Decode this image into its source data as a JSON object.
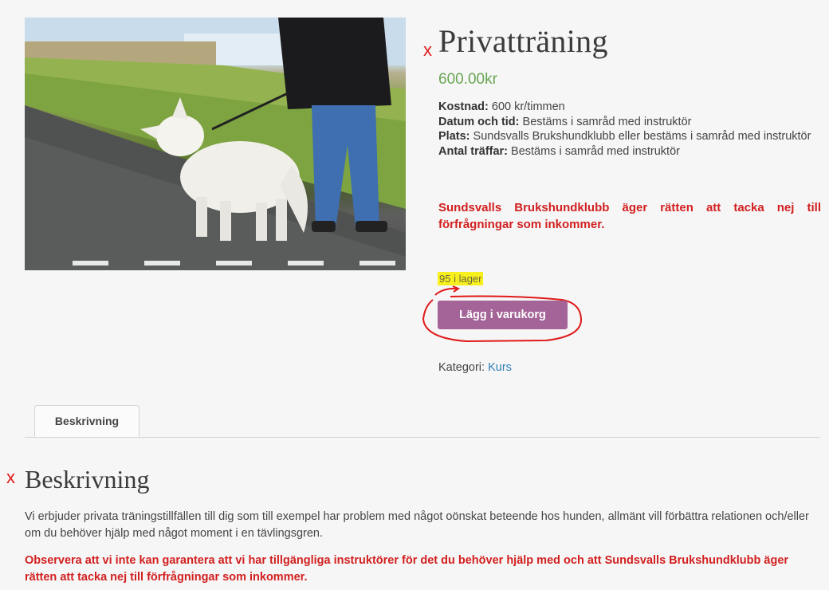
{
  "product": {
    "title": "Privatträning",
    "price": "600.00kr",
    "details": [
      {
        "label": "Kostnad:",
        "value": "600 kr/timmen"
      },
      {
        "label": "Datum och tid:",
        "value": "Bestäms i samråd med instruktör"
      },
      {
        "label": "Plats:",
        "value": "Sundsvalls Brukshundklubb eller bestäms i samråd med instruktör"
      },
      {
        "label": "Antal träffar:",
        "value": "Bestäms i samråd med instruktör"
      }
    ],
    "notice": "Sundsvalls Brukshundklubb äger rätten att tacka nej till förfrågningar som inkommer.",
    "stock": "95 i lager",
    "add_to_cart": "Lägg i varukorg",
    "category_label": "Kategori:",
    "category_value": "Kurs"
  },
  "tabs": [
    {
      "label": "Beskrivning"
    }
  ],
  "description": {
    "heading": "Beskrivning",
    "text": "Vi erbjuder privata träningstillfällen till dig som till exempel har problem med något oönskat beteende hos hunden, allmänt vill förbättra relationen och/eller om du behöver hjälp med något moment i en tävlingsgren.",
    "notice": "Observera att vi inte kan garantera att vi har tillgängliga instruktörer för det du behöver hjälp med och att Sundsvalls Brukshundklubb äger rätten att tacka nej till förfrågningar som inkommer."
  },
  "annotations": {
    "mark_glyph": "x",
    "mark_color": "#e01a1a"
  },
  "colors": {
    "price": "#69a653",
    "notice": "#d21f1f",
    "button": "#a46497",
    "highlight": "#f8ef1e",
    "link": "#2d7fb8"
  },
  "icons": {
    "annotation": "red-x-mark-icon",
    "arrow": "red-arrow-icon"
  }
}
